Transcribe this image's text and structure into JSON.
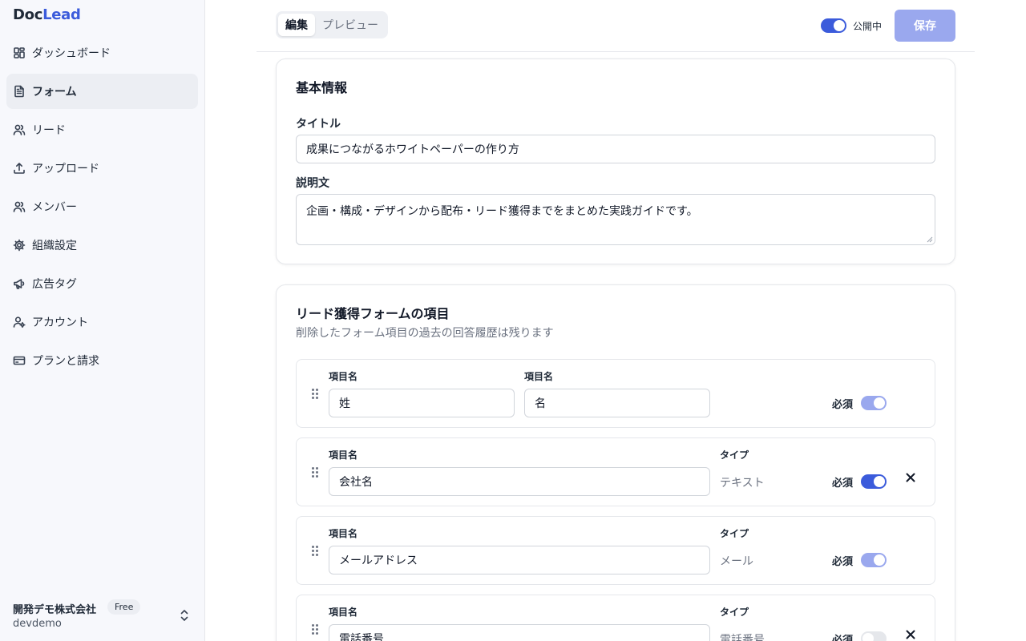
{
  "sidebar": {
    "logo_part1": "Doc",
    "logo_part2": "Lead",
    "items": [
      {
        "label": "ダッシュボード",
        "icon": "dashboard-icon"
      },
      {
        "label": "フォーム",
        "icon": "document-icon",
        "active": true
      },
      {
        "label": "リード",
        "icon": "users-icon"
      },
      {
        "label": "アップロード",
        "icon": "upload-icon"
      },
      {
        "label": "メンバー",
        "icon": "users-icon"
      },
      {
        "label": "組織設定",
        "icon": "gear-icon"
      },
      {
        "label": "広告タグ",
        "icon": "megaphone-icon"
      },
      {
        "label": "アカウント",
        "icon": "user-cog-icon"
      },
      {
        "label": "プランと請求",
        "icon": "credit-card-icon"
      }
    ],
    "org": {
      "name": "開発デモ株式会社",
      "plan": "Free",
      "slug": "devdemo"
    }
  },
  "header": {
    "tabs": [
      {
        "label": "編集",
        "active": true
      },
      {
        "label": "プレビュー",
        "active": false
      }
    ],
    "publish_label": "公開中",
    "publish_on": true,
    "save_label": "保存"
  },
  "basic": {
    "title": "基本情報",
    "title_label": "タイトル",
    "title_value": "成果につながるホワイトペーパーの作り方",
    "desc_label": "説明文",
    "desc_value": "企画・構成・デザインから配布・リード獲得までをまとめた実践ガイドです。"
  },
  "form_items": {
    "title": "リード獲得フォームの項目",
    "subtitle": "削除したフォーム項目の過去の回答履歴は残ります",
    "name_row": {
      "label1": "項目名",
      "value1": "姓",
      "label2": "項目名",
      "value2": "名",
      "required_label": "必須"
    },
    "items": [
      {
        "name_label": "項目名",
        "name": "会社名",
        "type_label": "タイプ",
        "type": "テキスト",
        "required_label": "必須"
      },
      {
        "name_label": "項目名",
        "name": "メールアドレス",
        "type_label": "タイプ",
        "type": "メール",
        "required_label": "必須"
      },
      {
        "name_label": "項目名",
        "name": "電話番号",
        "type_label": "タイプ",
        "type": "電話番号",
        "required_label": "必須"
      }
    ]
  },
  "colors": {
    "accent": "#3b5bdb",
    "accent_faded": "#9aa8ee",
    "sidebar_bg": "#f7f8fc"
  }
}
